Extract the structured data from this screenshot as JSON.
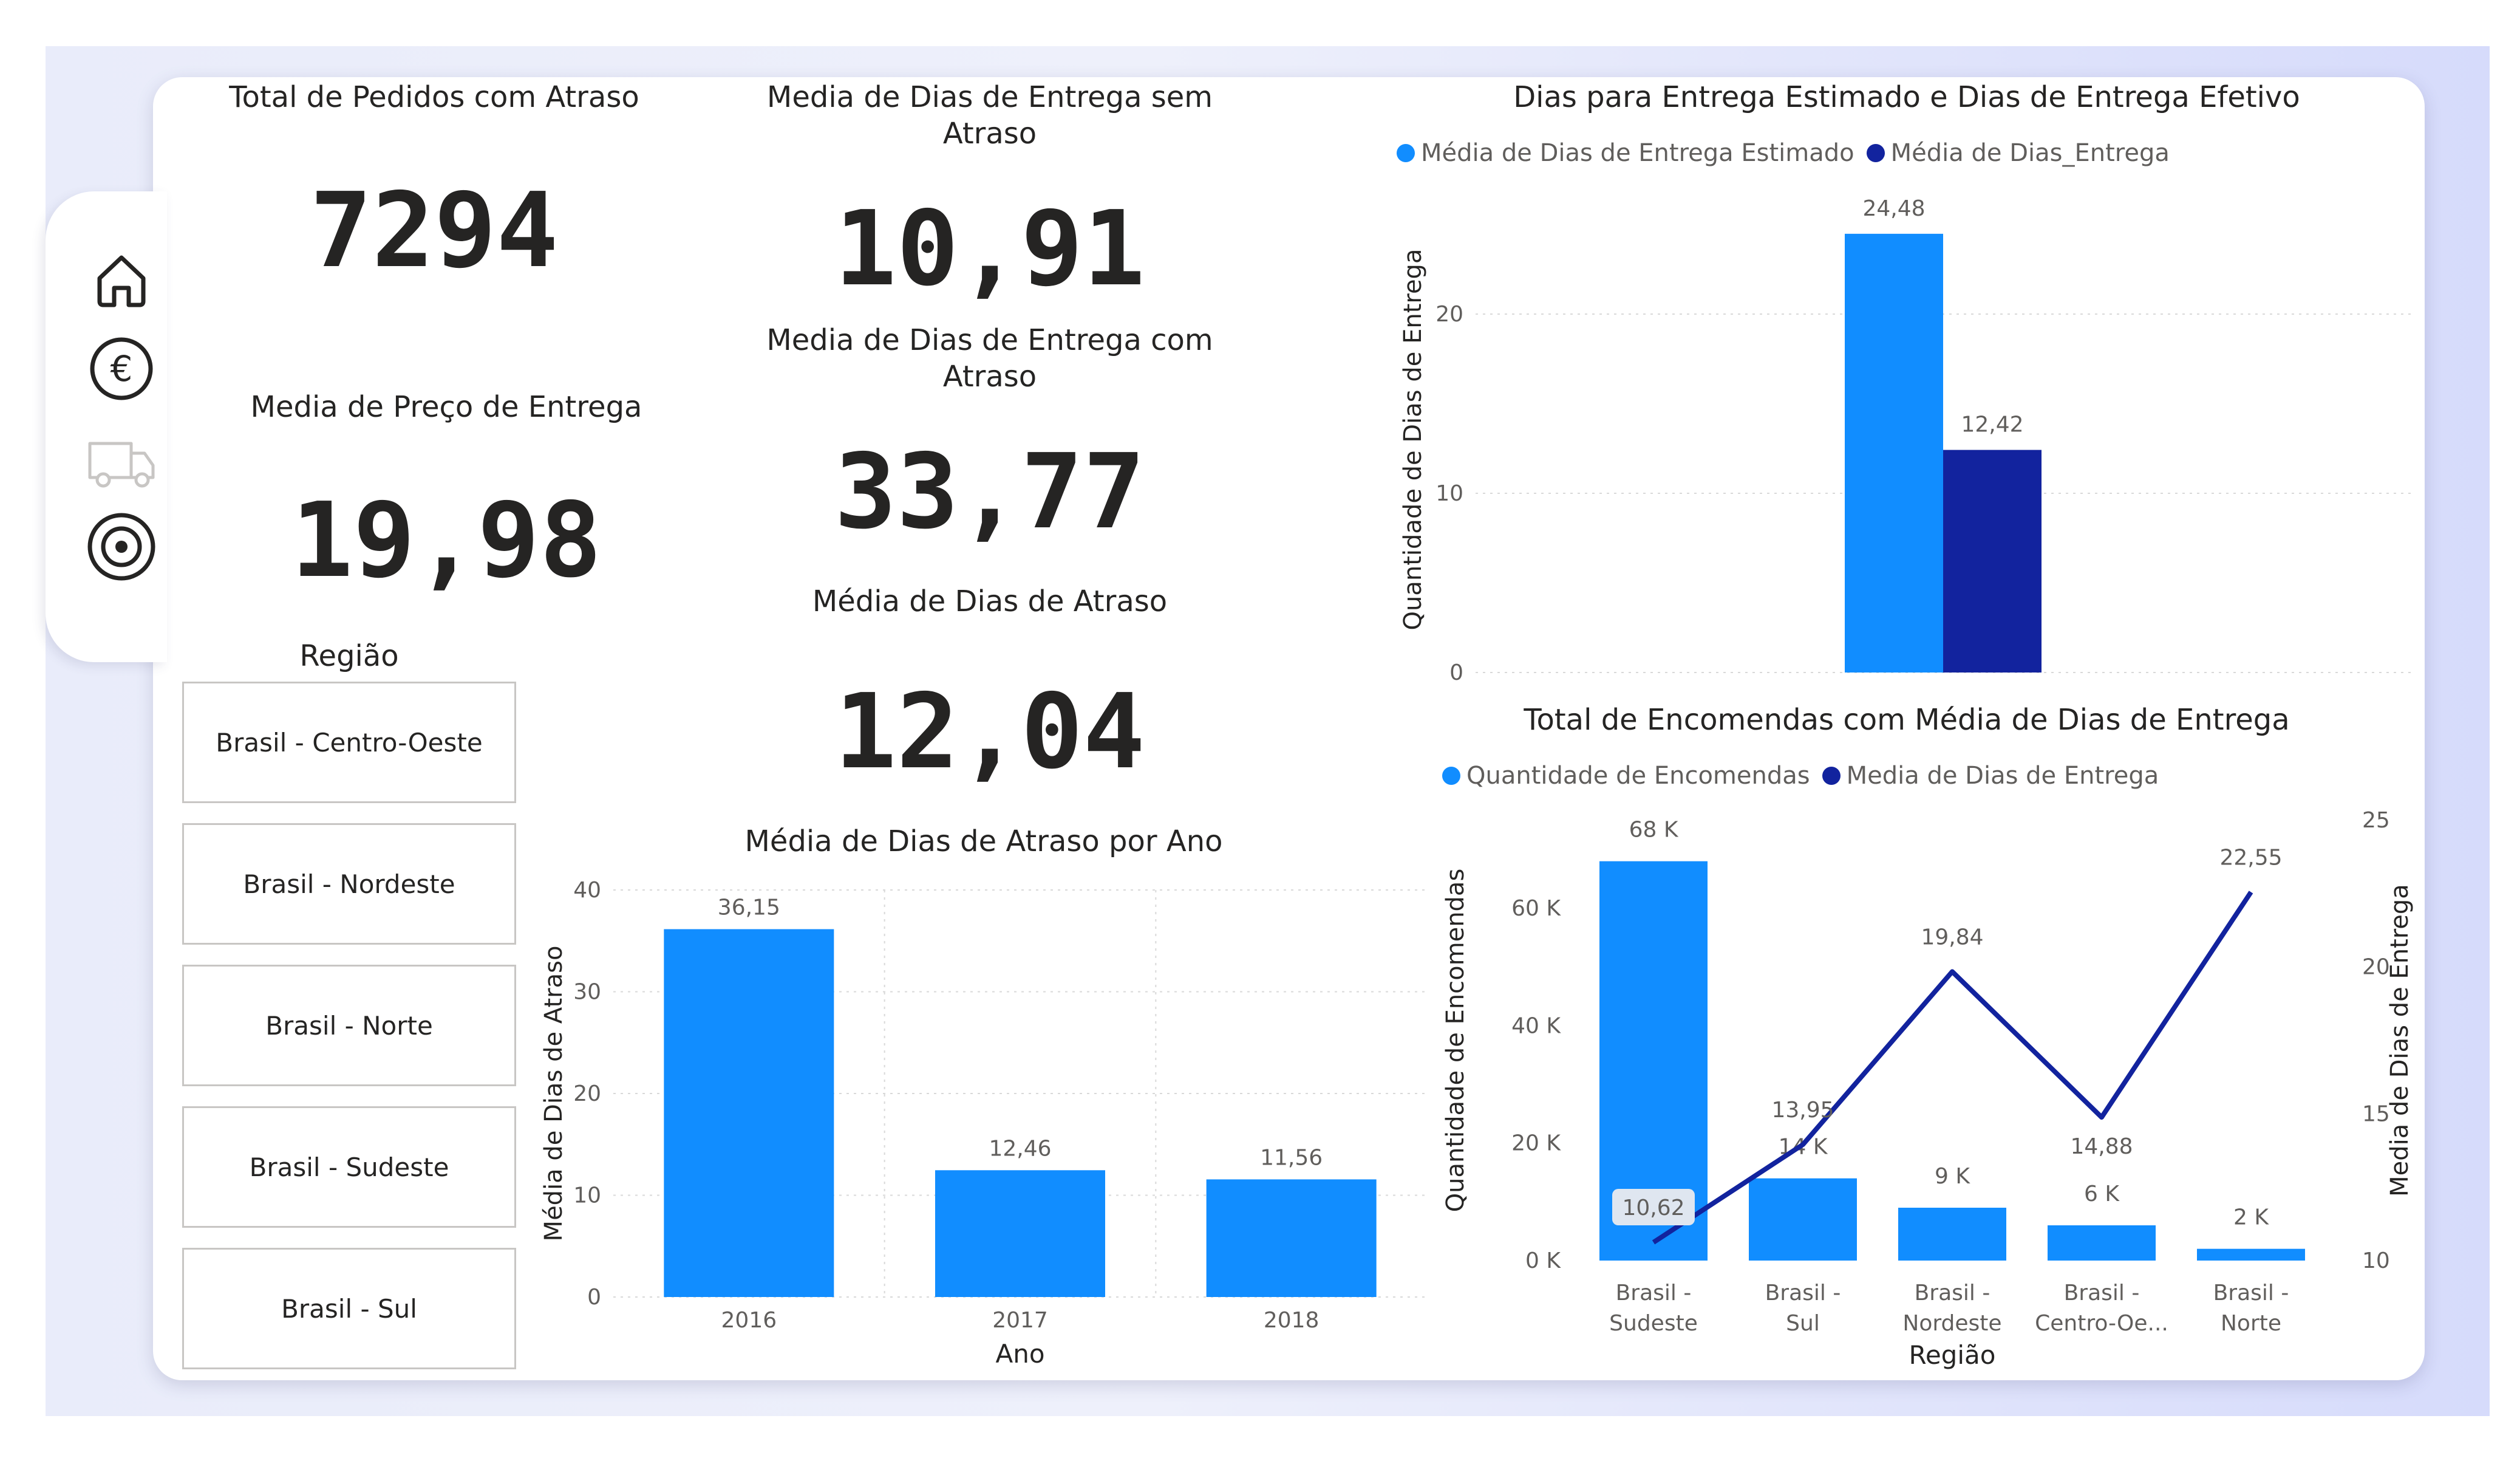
{
  "colors": {
    "light_blue": "#118dff",
    "dark_blue": "#12239e",
    "grid": "#d9d9d9",
    "text": "#252423",
    "muted": "#605e5c"
  },
  "nav": [
    "home-icon",
    "euro-icon",
    "truck-icon",
    "target-icon"
  ],
  "kpis": {
    "total_atraso": {
      "title": "Total de Pedidos com Atraso",
      "value": "7294"
    },
    "preco_entrega": {
      "title": "Media de Preço de Entrega",
      "value": "19,98"
    },
    "dias_sem_atraso": {
      "title": "Media de Dias de Entrega sem Atraso",
      "value": "10,91"
    },
    "dias_com_atraso": {
      "title": "Media de Dias de Entrega com Atraso",
      "value": "33,77"
    },
    "dias_atraso": {
      "title": "Média de Dias de Atraso",
      "value": "12,04"
    }
  },
  "slicer": {
    "title": "Região",
    "items": [
      "Brasil - Centro-Oeste",
      "Brasil - Nordeste",
      "Brasil - Norte",
      "Brasil - Sudeste",
      "Brasil - Sul"
    ]
  },
  "chart_data": [
    {
      "id": "atraso_ano",
      "type": "bar",
      "title": "Média de Dias de Atraso por Ano",
      "xlabel": "Ano",
      "ylabel": "Média de Dias de Atraso",
      "categories": [
        "2016",
        "2017",
        "2018"
      ],
      "values": [
        36.15,
        12.46,
        11.56
      ],
      "value_labels": [
        "36,15",
        "12,46",
        "11,56"
      ],
      "ylim": [
        0,
        40
      ],
      "yticks": [
        0,
        10,
        20,
        30,
        40
      ],
      "grid": true
    },
    {
      "id": "estimado_efetivo",
      "type": "bar",
      "title": "Dias para Entrega Estimado e Dias de Entrega Efetivo",
      "ylabel": "Quantidade de Dias de Entrega",
      "series": [
        {
          "name": "Média de Dias de Entrega Estimado",
          "values": [
            24.48
          ],
          "labels": [
            "24,48"
          ]
        },
        {
          "name": "Média de Dias_Entrega",
          "values": [
            12.42
          ],
          "labels": [
            "12,42"
          ]
        }
      ],
      "ylim": [
        0,
        26
      ],
      "yticks": [
        0,
        10,
        20
      ],
      "legend": "top-left",
      "grid": true
    },
    {
      "id": "encomendas_regiao",
      "type": "bar",
      "title": "Total de Encomendas com Média de Dias de Entrega",
      "xlabel": "Região",
      "ylabel": "Quantidade de Encomendas",
      "y2label": "Media de Dias de Entrega",
      "categories": [
        "Brasil - Sudeste",
        "Brasil - Sul",
        "Brasil - Nordeste",
        "Brasil - Centro-Oe...",
        "Brasil - Norte"
      ],
      "series": [
        {
          "name": "Quantidade de Encomendas",
          "type": "bar",
          "values": [
            68000,
            14000,
            9000,
            6000,
            2000
          ],
          "labels": [
            "68 K",
            "14 K",
            "9 K",
            "6 K",
            "2 K"
          ]
        },
        {
          "name": "Media de Dias de Entrega",
          "type": "line",
          "values": [
            10.62,
            13.95,
            19.84,
            14.88,
            22.55
          ],
          "labels": [
            "10,62",
            "13,95",
            "19,84",
            "14,88",
            "22,55"
          ]
        }
      ],
      "ylim": [
        0,
        75000
      ],
      "yticks": [
        0,
        20000,
        40000,
        60000
      ],
      "ytick_labels": [
        "0 K",
        "20 K",
        "40 K",
        "60 K"
      ],
      "y2lim": [
        10,
        25
      ],
      "y2ticks": [
        10,
        15,
        20,
        25
      ],
      "legend": "top-left",
      "grid": false
    }
  ]
}
